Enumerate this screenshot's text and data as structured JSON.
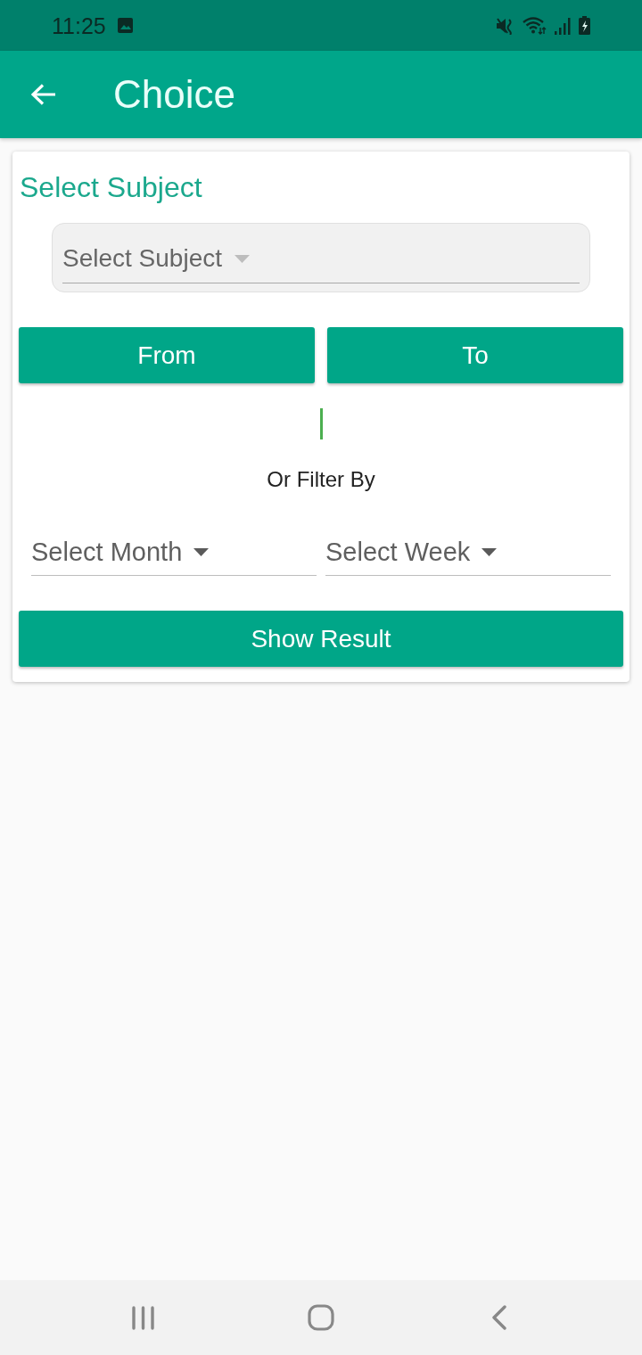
{
  "status_bar": {
    "time": "11:25"
  },
  "app_bar": {
    "title": "Choice"
  },
  "card": {
    "heading": "Select Subject",
    "subject_dropdown": {
      "placeholder": "Select Subject"
    },
    "range_buttons": [
      {
        "label": "From"
      },
      {
        "label": "To"
      }
    ],
    "filter_label": "Or Filter By",
    "filters": [
      {
        "placeholder": "Select Month"
      },
      {
        "placeholder": "Select Week"
      }
    ],
    "submit_button": "Show Result"
  }
}
